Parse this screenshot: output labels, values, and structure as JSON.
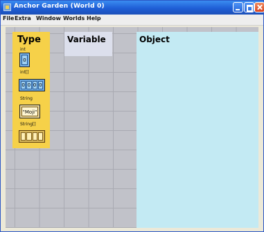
{
  "window": {
    "title": "Anchor Garden (World 0)"
  },
  "menubar": {
    "items": [
      "File",
      "Extra",
      "Window",
      "Worlds",
      "Help"
    ]
  },
  "type_panel": {
    "heading": "Type",
    "int": {
      "label": "int",
      "value": "0"
    },
    "int_array": {
      "label": "int[]",
      "values": [
        "0",
        "0",
        "0",
        "0"
      ]
    },
    "string": {
      "label": "String",
      "value": "\"Moji\""
    },
    "string_array": {
      "label": "String[]"
    }
  },
  "variable_panel": {
    "heading": "Variable"
  },
  "object_panel": {
    "heading": "Object"
  }
}
